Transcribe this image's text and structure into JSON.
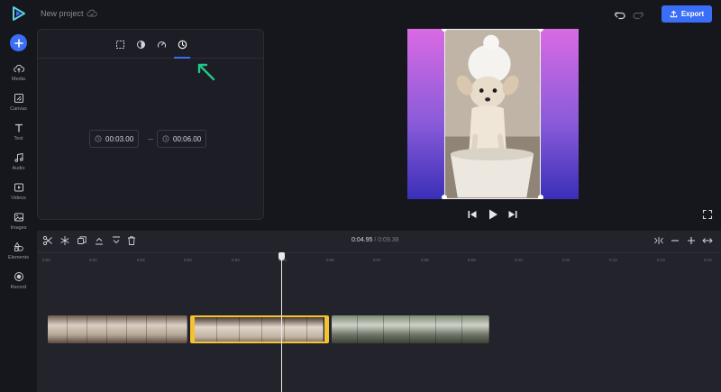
{
  "app": {
    "project_name": "New project",
    "export_label": "Export",
    "accent_color": "#3b6ef7"
  },
  "sidebar": {
    "items": [
      {
        "label": "Media",
        "icon": "cloud-upload-icon"
      },
      {
        "label": "Canvas",
        "icon": "canvas-icon"
      },
      {
        "label": "Text",
        "icon": "text-icon"
      },
      {
        "label": "Audio",
        "icon": "music-note-icon"
      },
      {
        "label": "Videos",
        "icon": "video-icon"
      },
      {
        "label": "Images",
        "icon": "image-icon"
      },
      {
        "label": "Elements",
        "icon": "shapes-icon"
      },
      {
        "label": "Record",
        "icon": "record-icon"
      }
    ]
  },
  "panel": {
    "tabs": [
      "crop-icon",
      "filter-icon",
      "speed-icon",
      "clock-icon"
    ],
    "active_tab": "clock-icon",
    "start_time": "00:03.00",
    "end_time": "00:06.00"
  },
  "timeline": {
    "current_time": "0:04.95",
    "separator": "/",
    "total_time": "0:09.38",
    "ticks": [
      "0:00",
      "0:01",
      "0:02",
      "0:03",
      "0:04",
      "0:05",
      "0:06",
      "0:07",
      "0:08",
      "0:09",
      "0:10",
      "0:11",
      "0:12",
      "0:13",
      "0:14"
    ],
    "clips": [
      {
        "name": "clip-1",
        "selected": false
      },
      {
        "name": "clip-2",
        "selected": true
      },
      {
        "name": "clip-3",
        "selected": false
      }
    ]
  }
}
